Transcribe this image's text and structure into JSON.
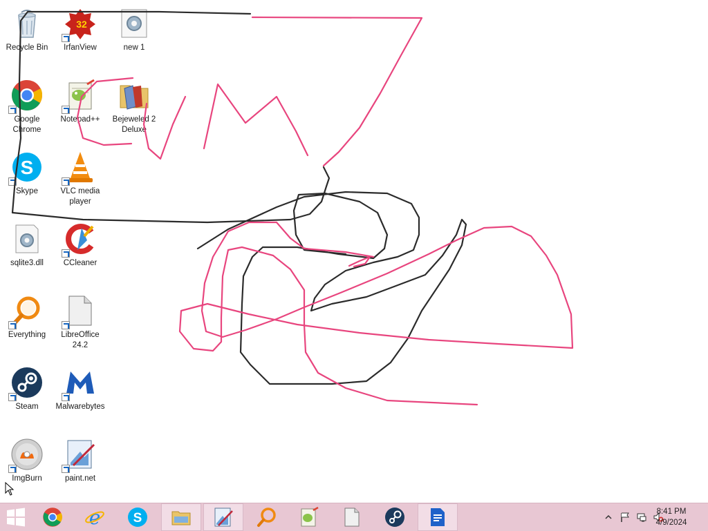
{
  "desktop": {
    "icons": [
      {
        "id": "recycle-bin",
        "label": "Recycle Bin",
        "icon": "recycle-bin-icon"
      },
      {
        "id": "irfanview",
        "label": "IrfanView",
        "icon": "irfanview-icon",
        "badge": "32"
      },
      {
        "id": "new1",
        "label": "new 1",
        "icon": "gear-file-icon"
      },
      {
        "id": "chrome",
        "label": "Google Chrome",
        "icon": "chrome-icon"
      },
      {
        "id": "notepadpp",
        "label": "Notepad++",
        "icon": "notepadpp-icon"
      },
      {
        "id": "bejeweled",
        "label": "Bejeweled 2 Deluxe",
        "icon": "folder-icon"
      },
      {
        "id": "skype",
        "label": "Skype",
        "icon": "skype-icon"
      },
      {
        "id": "vlc",
        "label": "VLC media player",
        "icon": "vlc-icon"
      },
      {
        "id": "sqlite",
        "label": "sqlite3.dll",
        "icon": "gear-file-icon"
      },
      {
        "id": "ccleaner",
        "label": "CCleaner",
        "icon": "ccleaner-icon"
      },
      {
        "id": "everything",
        "label": "Everything",
        "icon": "search-icon"
      },
      {
        "id": "libreoffice",
        "label": "LibreOffice 24.2",
        "icon": "document-icon"
      },
      {
        "id": "steam",
        "label": "Steam",
        "icon": "steam-icon"
      },
      {
        "id": "malwarebytes",
        "label": "Malwarebytes",
        "icon": "malwarebytes-icon"
      },
      {
        "id": "imgburn",
        "label": "ImgBurn",
        "icon": "disc-icon"
      },
      {
        "id": "paintnet",
        "label": "paint.net",
        "icon": "paintnet-icon"
      }
    ]
  },
  "drawing": {
    "pen_colors": {
      "black": "#2b2b2b",
      "pink": "#e8457e"
    }
  },
  "taskbar": {
    "background": "#e8c7d3",
    "buttons": [
      {
        "id": "start",
        "icon": "windows-logo-icon"
      },
      {
        "id": "chrome",
        "icon": "chrome-icon"
      },
      {
        "id": "ie",
        "icon": "internet-explorer-icon"
      },
      {
        "id": "skype",
        "icon": "skype-icon"
      },
      {
        "id": "explorer",
        "icon": "file-explorer-icon"
      },
      {
        "id": "paintnet",
        "icon": "paintnet-icon",
        "active": true
      },
      {
        "id": "everything",
        "icon": "search-icon"
      },
      {
        "id": "notepadpp",
        "icon": "notepadpp-icon"
      },
      {
        "id": "libreoffice",
        "icon": "document-icon"
      },
      {
        "id": "steam",
        "icon": "steam-icon"
      },
      {
        "id": "writer",
        "icon": "writer-icon",
        "active": true
      }
    ],
    "tray": {
      "icons": [
        "show-hidden-icons-chevron",
        "action-center-flag-icon",
        "network-icon",
        "volume-muted-icon"
      ],
      "time": "8:41 PM",
      "date": "4/9/2024"
    }
  }
}
